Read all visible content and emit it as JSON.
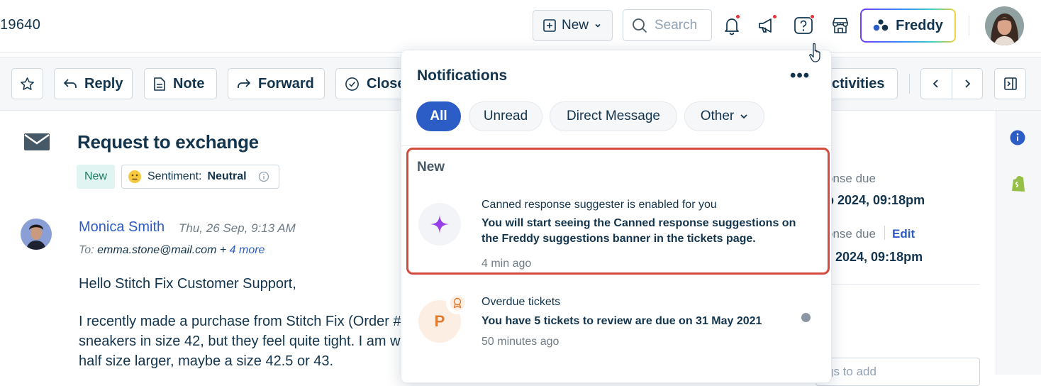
{
  "header": {
    "ticket_id": "19640",
    "new_button": "New",
    "search_placeholder": "Search",
    "freddy_label": "Freddy"
  },
  "toolbar": {
    "reply": "Reply",
    "note": "Note",
    "forward": "Forward",
    "close": "Close",
    "activities": "ctivities"
  },
  "ticket": {
    "subject": "Request to exchange",
    "status": "New",
    "sentiment_label": "Sentiment:",
    "sentiment_value": "Neutral"
  },
  "message": {
    "sender": "Monica Smith",
    "time": "Thu, 26 Sep, 9:13 AM",
    "to_label": "To:",
    "to_email": "emma.stone@mail.com +",
    "to_more": "4 more",
    "lines": [
      "Hello Stitch Fix Customer Support,",
      "I recently made a purchase from Stitch Fix (Order #",
      "sneakers in size 42, but they feel quite tight. I am w",
      "half size larger, maybe a size 42.5 or 43."
    ]
  },
  "sidebar_peek": {
    "due1_label": "onse due",
    "due1_value": "p 2024, 09:18pm",
    "due2_label": "onse due",
    "due2_edit": "Edit",
    "due2_value": "2024, 09:18pm",
    "tags_placeholder": "gs to add"
  },
  "notifications": {
    "title": "Notifications",
    "more": "•••",
    "filters": [
      "All",
      "Unread",
      "Direct Message",
      "Other"
    ],
    "section_new": "New",
    "items": [
      {
        "title": "Canned response suggester is enabled for you",
        "body_line1": "You will start seeing the Canned response suggestions on",
        "body_line2": "the Freddy suggestions banner in the tickets page.",
        "time": "4 min ago"
      },
      {
        "avatar_letter": "P",
        "title": "Overdue tickets",
        "body_pre": "You have ",
        "body_count": "5",
        "body_post": " tickets to review are due on 31 May 2021",
        "time": "50 minutes ago"
      }
    ]
  },
  "colors": {
    "primary_blue": "#2c5cc5",
    "text_dark": "#12344d",
    "highlight_red": "#d54a3e",
    "badge_red": "#e43538"
  }
}
